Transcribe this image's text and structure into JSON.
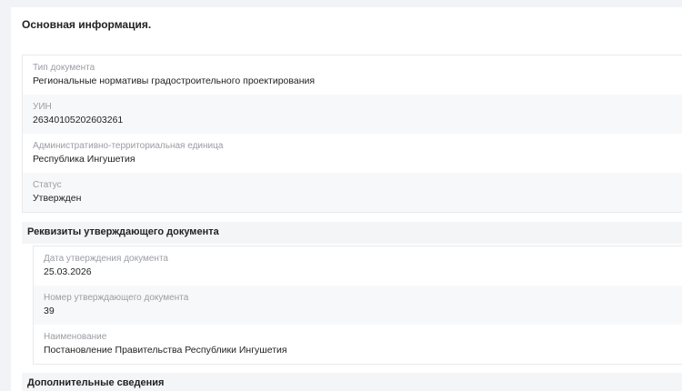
{
  "main_section": {
    "title": "Основная информация.",
    "fields": [
      {
        "label": "Тип документа",
        "value": "Региональные нормативы градостроительного проектирования"
      },
      {
        "label": "УИН",
        "value": "26340105202603261"
      },
      {
        "label": "Административно-территориальная единица",
        "value": "Республика Ингушетия"
      },
      {
        "label": "Статус",
        "value": "Утвержден"
      }
    ]
  },
  "approval_section": {
    "title": "Реквизиты утверждающего документа",
    "fields": [
      {
        "label": "Дата утверждения документа",
        "value": "25.03.2026"
      },
      {
        "label": "Номер утверждающего документа",
        "value": "39"
      },
      {
        "label": "Наименование",
        "value": "Постановление Правительства Республики Ингушетия"
      }
    ]
  },
  "extra_section": {
    "title": "Дополнительные сведения"
  }
}
